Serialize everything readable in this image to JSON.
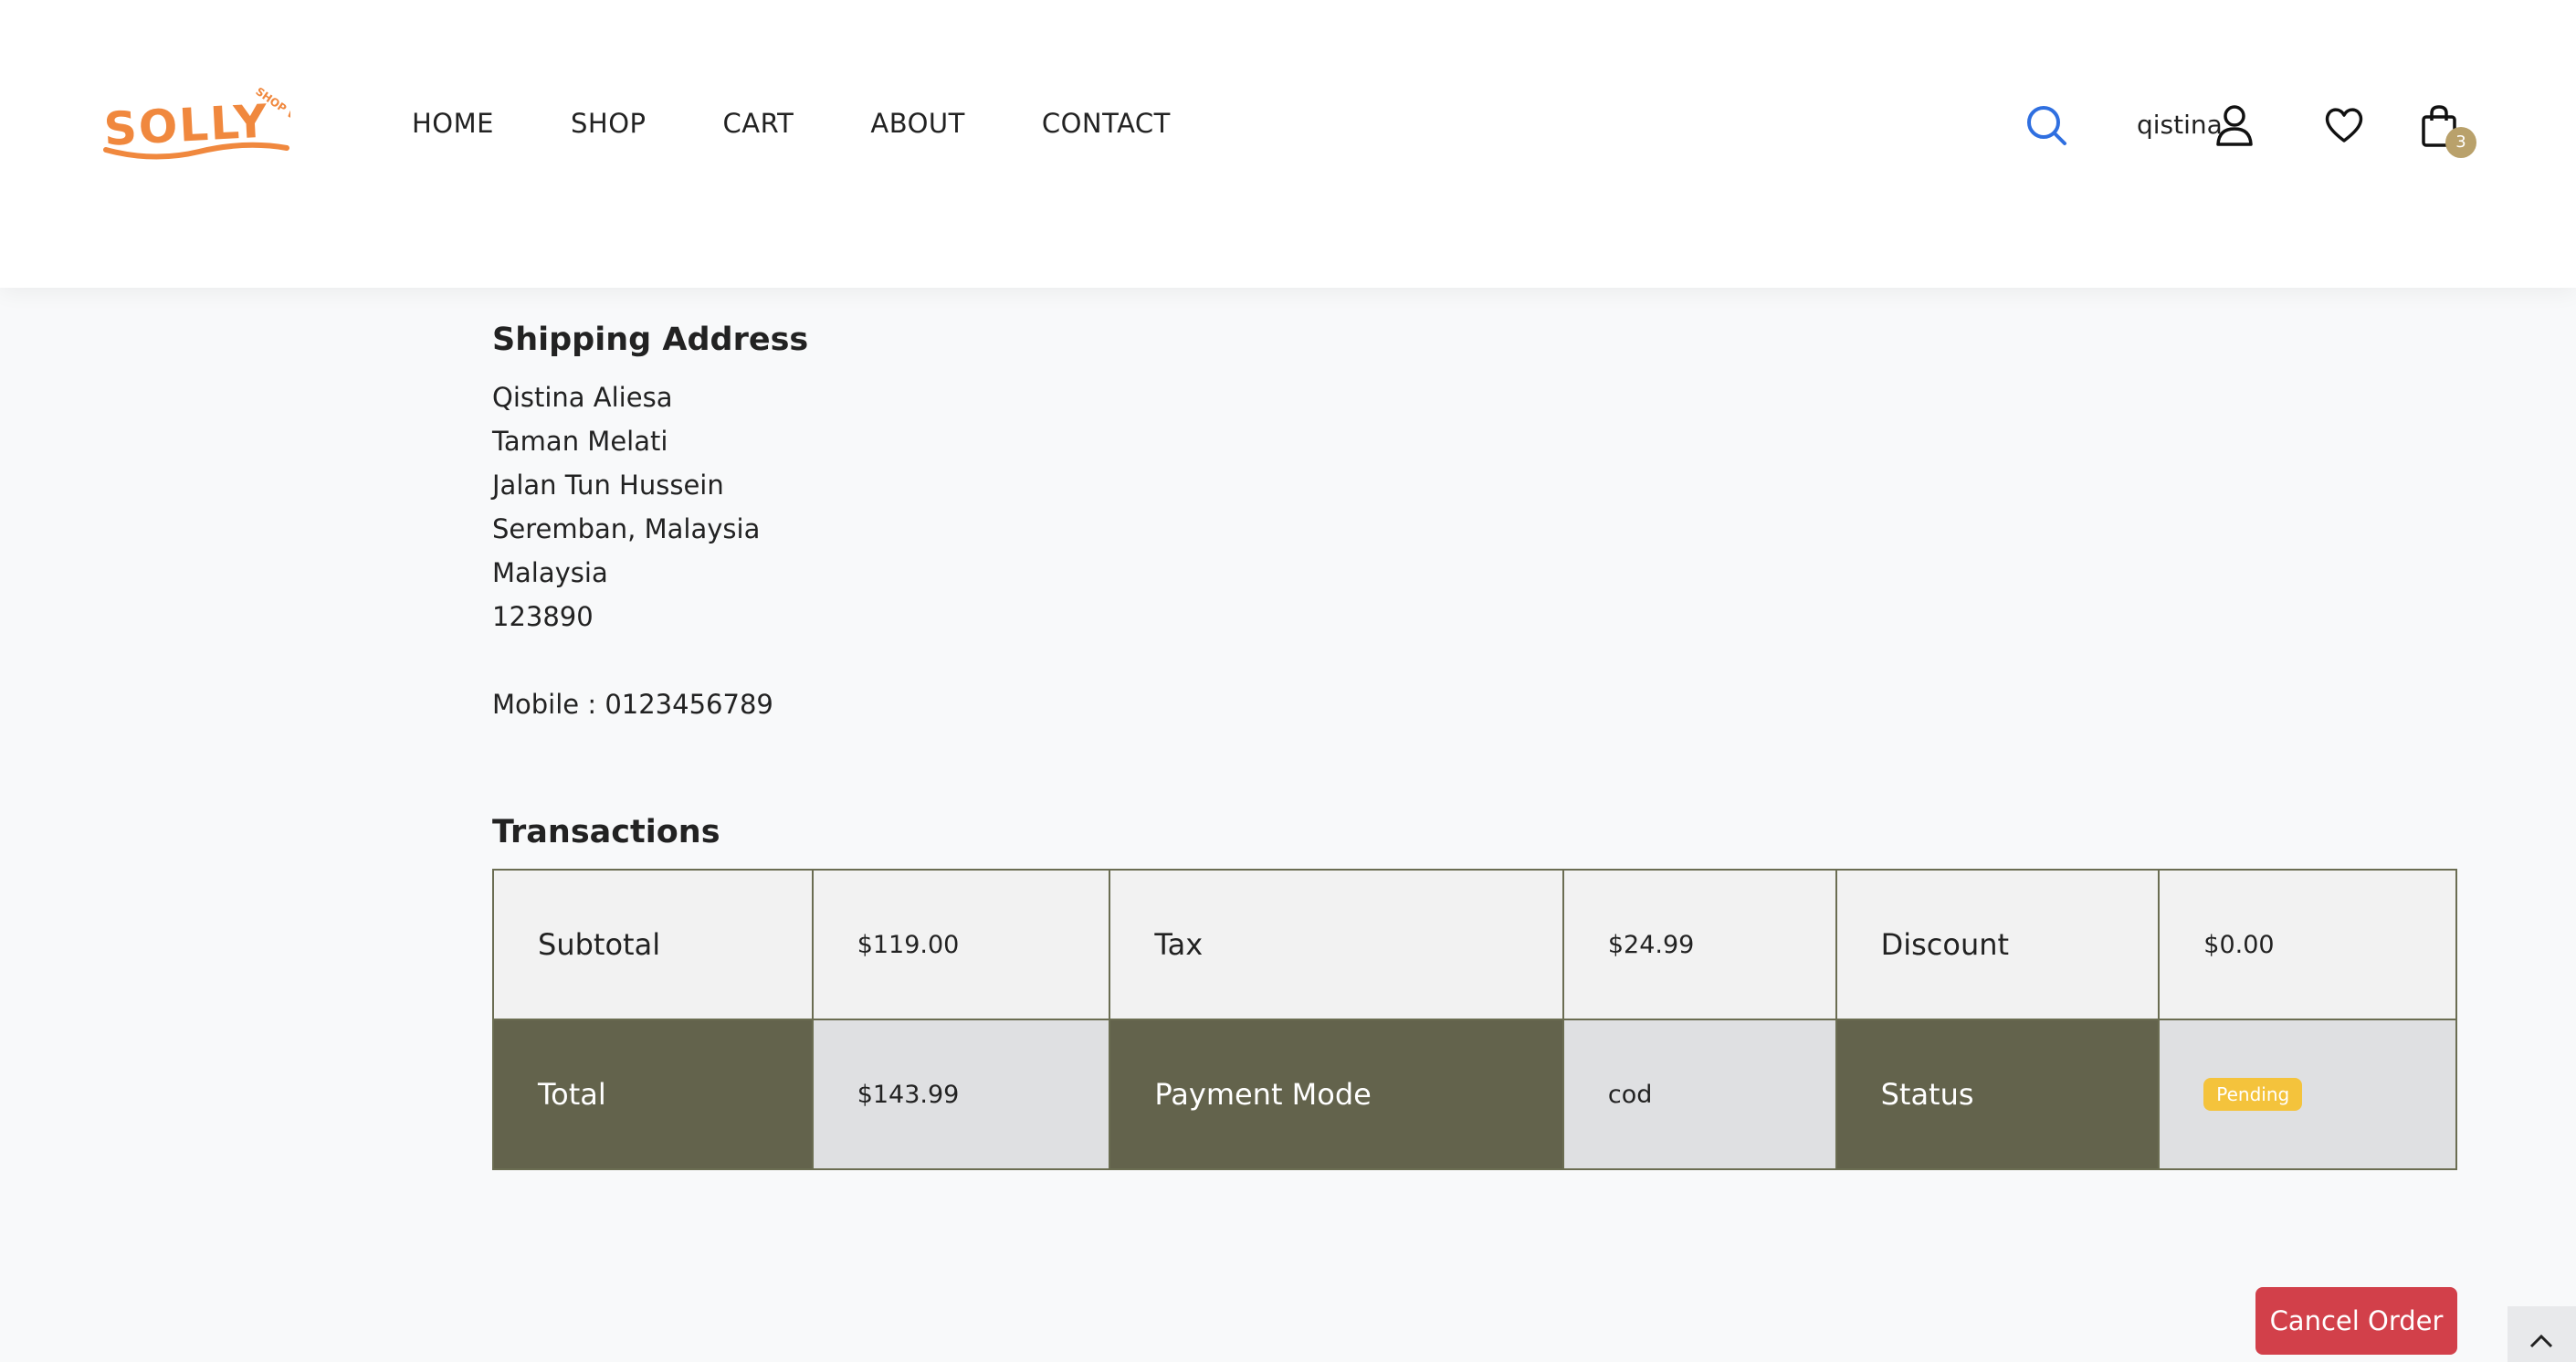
{
  "header": {
    "logo_text": "SOLLY",
    "logo_subtext": "SHOP WE",
    "nav": [
      "HOME",
      "SHOP",
      "CART",
      "ABOUT",
      "CONTACT"
    ],
    "username": "qistina",
    "cart_count": "3",
    "icons": [
      "search-icon",
      "user-icon",
      "heart-icon",
      "shopping-bag-icon"
    ],
    "colors": {
      "brand": "#f0883e",
      "search": "#2f6fe0"
    }
  },
  "shipping": {
    "title": "Shipping Address",
    "lines": [
      "Qistina Aliesa",
      "Taman Melati",
      "Jalan Tun Hussein",
      "Seremban, Malaysia",
      "Malaysia",
      "123890"
    ],
    "mobile": "Mobile : 0123456789"
  },
  "transactions": {
    "title": "Transactions",
    "row1": [
      {
        "label": "Subtotal",
        "value": "$119.00"
      },
      {
        "label": "Tax",
        "value": "$24.99"
      },
      {
        "label": "Discount",
        "value": "$0.00"
      }
    ],
    "row2": [
      {
        "label": "Total",
        "value": "$143.99"
      },
      {
        "label": "Payment Mode",
        "value": "cod"
      },
      {
        "label": "Status",
        "value": "Pending"
      }
    ],
    "colors": {
      "dark_label": "#63634c",
      "status_badge": "#f4c33c"
    }
  },
  "actions": {
    "cancel_label": "Cancel Order",
    "cancel_color": "#d2404a"
  }
}
